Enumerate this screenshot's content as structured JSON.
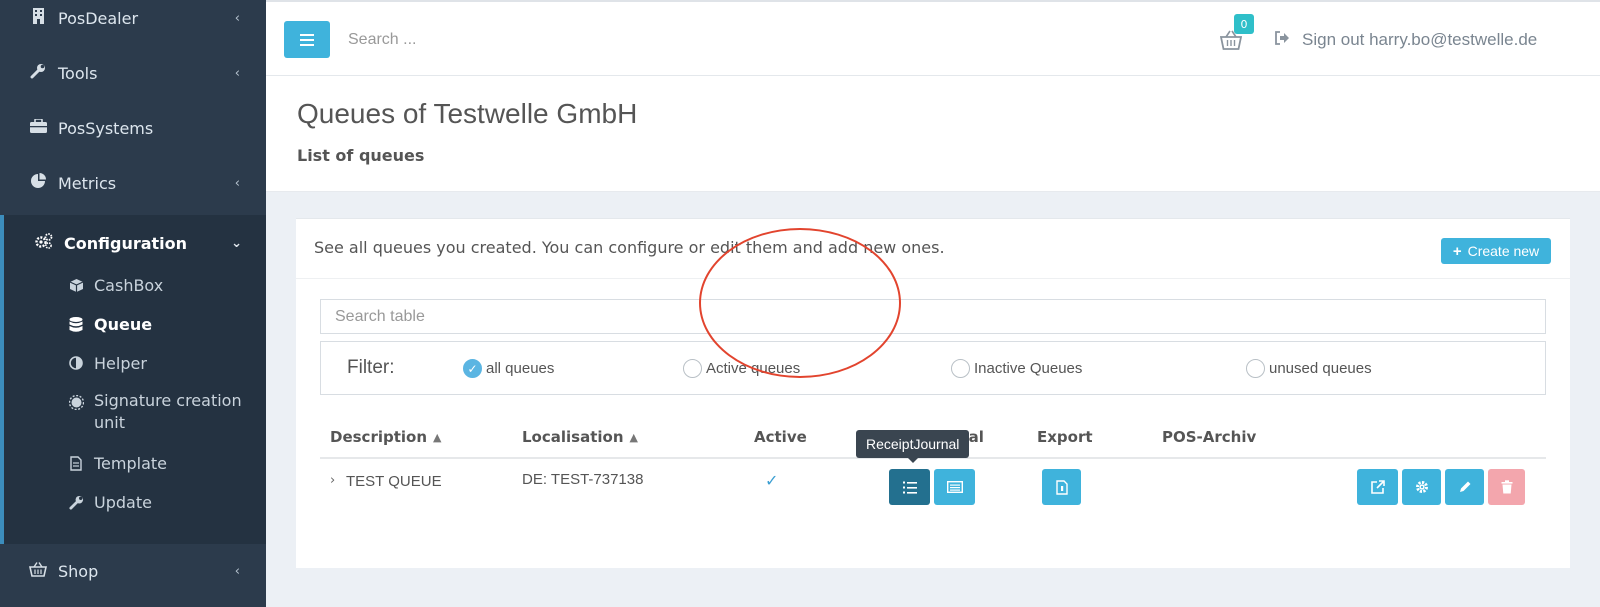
{
  "sidebar": {
    "items": [
      {
        "label": "PosDealer",
        "icon": "building-icon",
        "chevron": "‹"
      },
      {
        "label": "Tools",
        "icon": "wrench-icon",
        "chevron": "‹"
      },
      {
        "label": "PosSystems",
        "icon": "briefcase-icon",
        "chevron": ""
      },
      {
        "label": "Metrics",
        "icon": "pie-chart-icon",
        "chevron": "‹"
      }
    ],
    "configuration": {
      "label": "Configuration",
      "icon": "cogs-icon",
      "chevron": "⌄",
      "children": [
        {
          "label": "CashBox",
          "icon": "cube-icon"
        },
        {
          "label": "Queue",
          "icon": "database-icon",
          "active": true
        },
        {
          "label": "Helper",
          "icon": "adjust-icon"
        },
        {
          "label": "Signature creation unit",
          "icon": "certificate-icon"
        },
        {
          "label": "Template",
          "icon": "file-icon"
        },
        {
          "label": "Update",
          "icon": "wrench-icon"
        }
      ]
    },
    "shop": {
      "label": "Shop",
      "icon": "basket-icon",
      "chevron": "‹"
    }
  },
  "topbar": {
    "search_placeholder": "Search ...",
    "cart_count": "0",
    "signout_label": "Sign out harry.bo@testwelle.de"
  },
  "page": {
    "title": "Queues of Testwelle GmbH",
    "subtitle": "List of queues"
  },
  "box": {
    "description": "See all queues you created. You can configure or edit them and add new ones.",
    "create_label": "Create new",
    "table_search_placeholder": "Search table"
  },
  "filter": {
    "label": "Filter:",
    "options": [
      {
        "label": "all queues",
        "checked": true
      },
      {
        "label": "Active queues",
        "checked": false
      },
      {
        "label": "Inactive Queues",
        "checked": false
      },
      {
        "label": "unused queues",
        "checked": false
      }
    ]
  },
  "table": {
    "headers": {
      "description": "Description",
      "localisation": "Localisation",
      "active": "Active",
      "journal": "Journal",
      "export": "Export",
      "pos_archiv": "POS-Archiv"
    },
    "rows": [
      {
        "description": "TEST QUEUE",
        "localisation": "DE: TEST-737138",
        "active": true
      }
    ]
  },
  "tooltip": {
    "text": "ReceiptJournal"
  },
  "colors": {
    "sidebar": "#2c3b4c",
    "accent": "#3fb3dc",
    "dark_button": "#23708f",
    "danger_button": "#f3a6ad",
    "annotation": "#e2442e"
  }
}
